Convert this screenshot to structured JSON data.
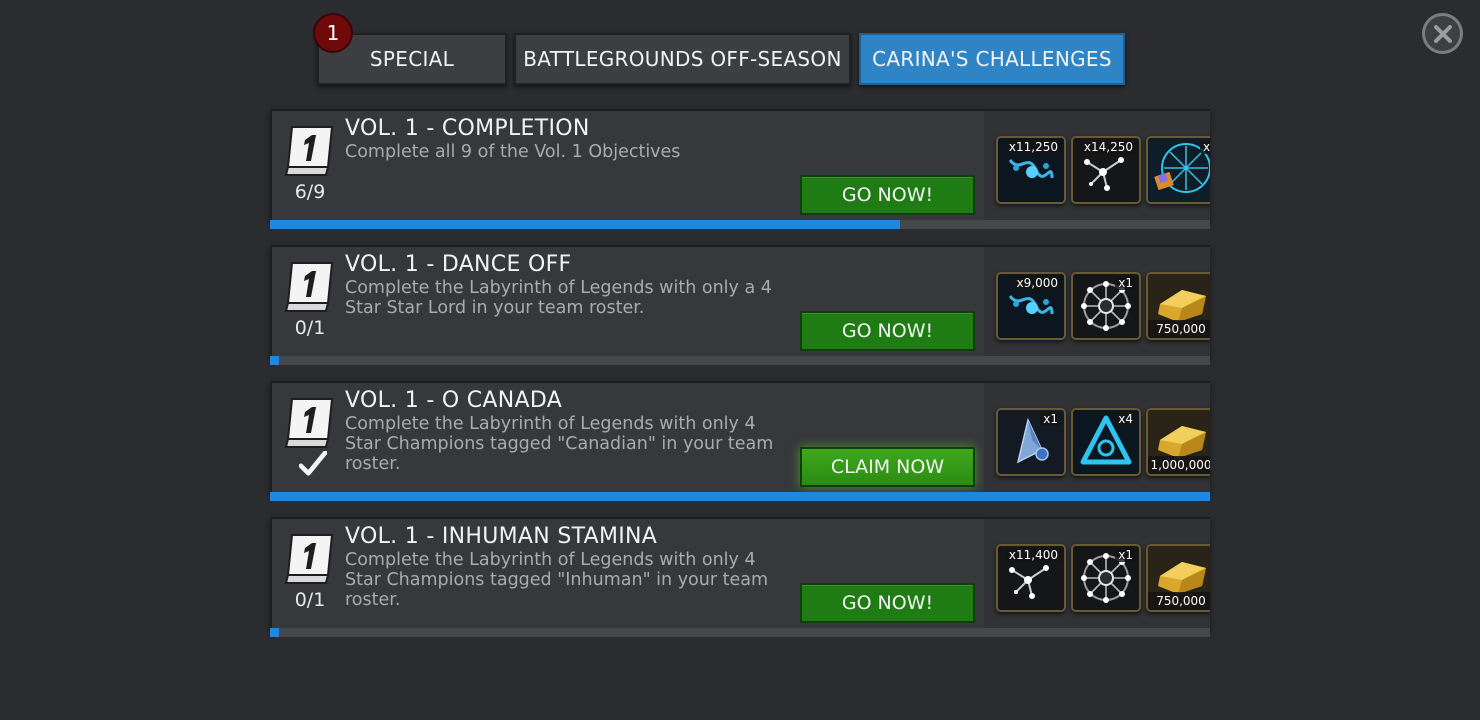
{
  "tabs": {
    "badge": "1",
    "special": "SPECIAL",
    "battlegrounds": "BATTLEGROUNDS OFF-SEASON",
    "carina": "CARINA'S CHALLENGES",
    "active": "carina"
  },
  "colors": {
    "accent": "#2f84c6",
    "progress": "#1e88e0",
    "go_button": "#1f7c15",
    "claim_button": "#3ea81d",
    "badge": "#6e0a0a"
  },
  "challenges": [
    {
      "title": "VOL. 1 - COMPLETION",
      "description": "Complete all 9 of the Vol. 1 Objectives",
      "counter": "6/9",
      "progress": 0.67,
      "action": "GO NOW!",
      "rewards": [
        {
          "icon": "blue-shard-icon",
          "label": "x11,250"
        },
        {
          "icon": "constellation-shard-icon",
          "label": "x14,250"
        },
        {
          "icon": "crystal-icon",
          "label": "x"
        }
      ]
    },
    {
      "title": "VOL. 1 - DANCE OFF",
      "description": "Complete the Labyrinth of Legends with only a 4 Star Star Lord in your team roster.",
      "counter": "0/1",
      "progress": 0.01,
      "action": "GO NOW!",
      "rewards": [
        {
          "icon": "blue-shard-icon",
          "label": "x9,000"
        },
        {
          "icon": "network-crystal-icon",
          "label": "x1"
        },
        {
          "icon": "gold-icon",
          "label": "750,000"
        }
      ]
    },
    {
      "title": "VOL. 1 - O CANADA",
      "description": "Complete the Labyrinth of Legends with only 4 Star Champions tagged \"Canadian\" in your team roster.",
      "counter": "",
      "completed": true,
      "progress": 1.0,
      "action": "CLAIM NOW",
      "rewards": [
        {
          "icon": "star-crystal-icon",
          "label": "x1"
        },
        {
          "icon": "catalyst-icon",
          "label": "x4"
        },
        {
          "icon": "gold-icon",
          "label": "1,000,000"
        }
      ]
    },
    {
      "title": "VOL. 1 - INHUMAN STAMINA",
      "description": "Complete the Labyrinth of Legends with only 4 Star Champions tagged \"Inhuman\" in your team roster.",
      "counter": "0/1",
      "progress": 0.01,
      "action": "GO NOW!",
      "rewards": [
        {
          "icon": "constellation-shard-icon",
          "label": "x11,400"
        },
        {
          "icon": "network-crystal-icon",
          "label": "x1"
        },
        {
          "icon": "gold-icon",
          "label": "750,000"
        }
      ]
    }
  ]
}
